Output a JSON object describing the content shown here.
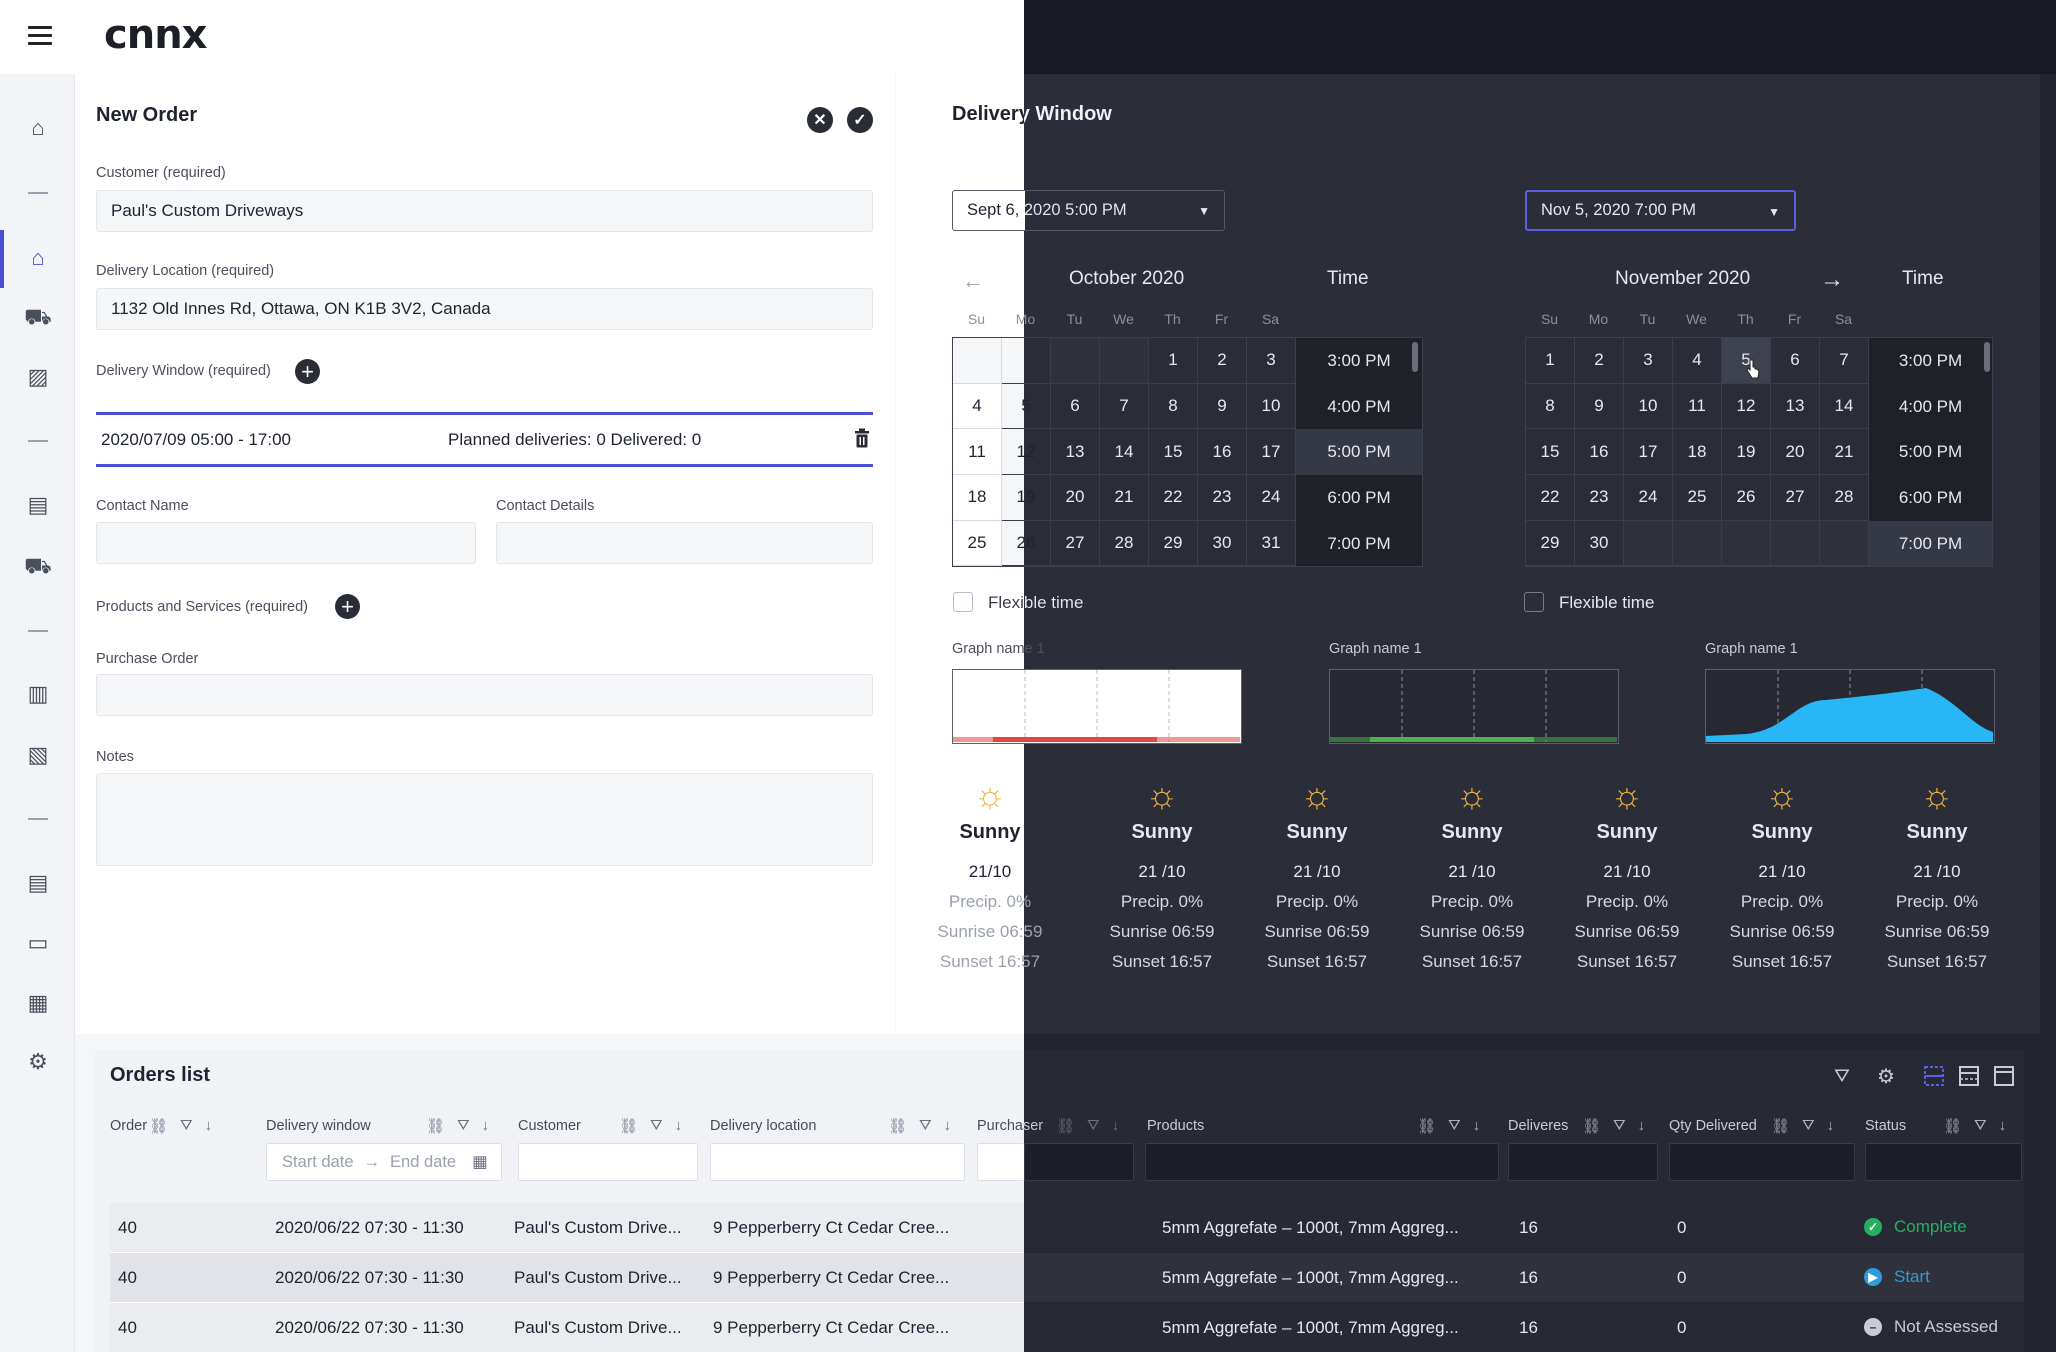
{
  "brand": {
    "logo": "cnnx"
  },
  "form": {
    "title": "New Order",
    "customer_label": "Customer (required)",
    "customer_value": "Paul's Custom Driveways",
    "location_label": "Delivery Location (required)",
    "location_value": "1132 Old Innes Rd, Ottawa, ON K1B 3V2, Canada",
    "window_label": "Delivery Window (required)",
    "window_value": "2020/07/09 05:00 - 17:00",
    "window_stats": "Planned deliveries: 0 Delivered: 0",
    "contact_name_label": "Contact Name",
    "contact_details_label": "Contact Details",
    "products_label": "Products and Services (required)",
    "po_label": "Purchase Order",
    "notes_label": "Notes"
  },
  "delivery_window": {
    "title": "Delivery Window",
    "start_select": "Sept 6, 2020 5:00 PM",
    "end_select": "Nov 5, 2020 7:00 PM",
    "days": [
      "Su",
      "Mo",
      "Tu",
      "We",
      "Th",
      "Fr",
      "Sa"
    ],
    "time_header": "Time",
    "flexible_label": "Flexible time",
    "left_cal": {
      "month": "October 2020",
      "cells": [
        "",
        "",
        "",
        "",
        "1",
        "2",
        "3",
        "4",
        "5",
        "6",
        "7",
        "8",
        "9",
        "10",
        "11",
        "12",
        "13",
        "14",
        "15",
        "16",
        "17",
        "18",
        "19",
        "20",
        "21",
        "22",
        "23",
        "24",
        "25",
        "26",
        "27",
        "28",
        "29",
        "30",
        "31"
      ],
      "times": [
        "3:00 PM",
        "4:00 PM",
        "5:00 PM",
        "6:00 PM",
        "7:00 PM"
      ],
      "selected_time": "5:00 PM"
    },
    "right_cal": {
      "month": "November 2020",
      "cells": [
        "1",
        "2",
        "3",
        "4",
        "5",
        "6",
        "7",
        "8",
        "9",
        "10",
        "11",
        "12",
        "13",
        "14",
        "15",
        "16",
        "17",
        "18",
        "19",
        "20",
        "21",
        "22",
        "23",
        "24",
        "25",
        "26",
        "27",
        "28",
        "29",
        "30",
        "",
        "",
        "",
        "",
        ""
      ],
      "times": [
        "3:00 PM",
        "4:00 PM",
        "5:00 PM",
        "6:00 PM",
        "7:00 PM"
      ],
      "selected_time": "7:00 PM",
      "selected_day": "5"
    },
    "graphs": [
      {
        "label": "Graph name 1",
        "color": "#e2463f"
      },
      {
        "label": "Graph name 1",
        "color": "#4caf50"
      },
      {
        "label": "Graph name 1",
        "color": "#29b6f6"
      }
    ],
    "weather": [
      {
        "cond": "Sunny",
        "temp": "21/10",
        "precip": "Precip. 0%",
        "sunrise": "Sunrise 06:59",
        "sunset": "Sunset 16:57"
      },
      {
        "cond": "Sunny",
        "temp": "21 /10",
        "precip": "Precip. 0%",
        "sunrise": "Sunrise 06:59",
        "sunset": "Sunset 16:57"
      },
      {
        "cond": "Sunny",
        "temp": "21 /10",
        "precip": "Precip. 0%",
        "sunrise": "Sunrise 06:59",
        "sunset": "Sunset 16:57"
      },
      {
        "cond": "Sunny",
        "temp": "21 /10",
        "precip": "Precip. 0%",
        "sunrise": "Sunrise 06:59",
        "sunset": "Sunset 16:57"
      },
      {
        "cond": "Sunny",
        "temp": "21 /10",
        "precip": "Precip. 0%",
        "sunrise": "Sunrise 06:59",
        "sunset": "Sunset 16:57"
      },
      {
        "cond": "Sunny",
        "temp": "21 /10",
        "precip": "Precip. 0%",
        "sunrise": "Sunrise 06:59",
        "sunset": "Sunset 16:57"
      },
      {
        "cond": "Sunny",
        "temp": "21 /10",
        "precip": "Precip. 0%",
        "sunrise": "Sunrise 06:59",
        "sunset": "Sunset 16:57"
      }
    ]
  },
  "orders": {
    "title": "Orders list",
    "columns": {
      "order": "Order",
      "window": "Delivery window",
      "customer": "Customer",
      "location": "Delivery location",
      "purchaser": "Purchaser",
      "products": "Products",
      "deliveries": "Deliveres",
      "qty": "Qty Delivered",
      "status": "Status"
    },
    "date_start_placeholder": "Start date",
    "date_end_placeholder": "End date",
    "rows": [
      {
        "order": "40",
        "window": "2020/06/22 07:30 - 11:30",
        "customer": "Paul's Custom Drive...",
        "location": "9 Pepperberry Ct Cedar Cree...",
        "products": "5mm Aggrefate – 1000t, 7mm Aggreg...",
        "deliveries": "16",
        "qty": "0",
        "status": "Complete",
        "status_color": "#27ae60"
      },
      {
        "order": "40",
        "window": "2020/06/22 07:30 - 11:30",
        "customer": "Paul's Custom Drive...",
        "location": "9 Pepperberry Ct Cedar Cree...",
        "products": "5mm Aggrefate – 1000t, 7mm Aggreg...",
        "deliveries": "16",
        "qty": "0",
        "status": "Start",
        "status_color": "#2d9cdb"
      },
      {
        "order": "40",
        "window": "2020/06/22 07:30 - 11:30",
        "customer": "Paul's Custom Drive...",
        "location": "9 Pepperberry Ct Cedar Cree...",
        "products": "5mm Aggrefate – 1000t, 7mm Aggreg...",
        "deliveries": "16",
        "qty": "0",
        "status": "Not Assessed",
        "status_color": "#c9ccd3"
      }
    ]
  },
  "colors": {
    "accent": "#4b4fd6",
    "dark_bg": "#22252f"
  }
}
